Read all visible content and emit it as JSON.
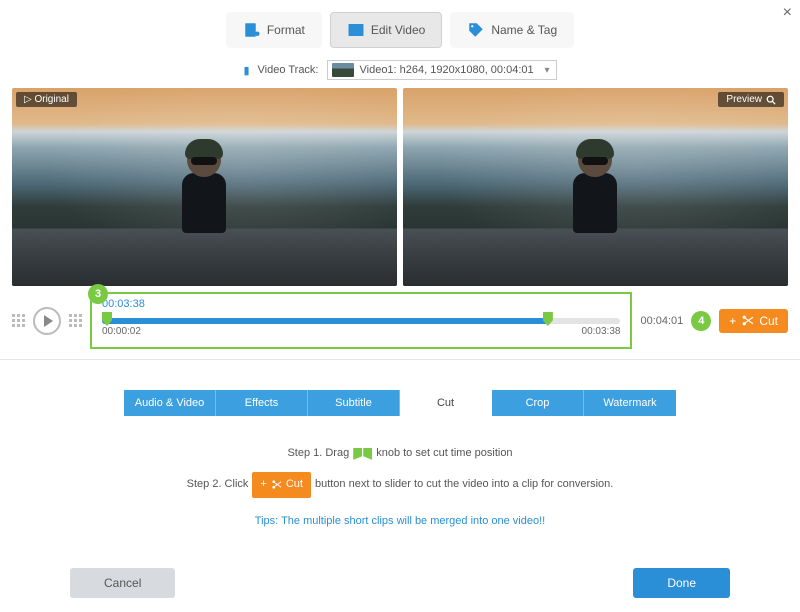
{
  "topTabs": {
    "format": "Format",
    "editVideo": "Edit Video",
    "nameTag": "Name & Tag"
  },
  "trackRow": {
    "label": "Video Track:",
    "selected": "Video1: h264, 1920x1080, 00:04:01"
  },
  "badges": {
    "original": "▷ Original",
    "preview": "Preview"
  },
  "timeline": {
    "current": "00:03:38",
    "total": "00:04:01",
    "startLabel": "00:00:02",
    "endLabel": "00:03:38",
    "cutLabel": "Cut",
    "badge3": "3",
    "badge4": "4"
  },
  "subTabs": {
    "audioVideo": "Audio & Video",
    "effects": "Effects",
    "subtitle": "Subtitle",
    "cut": "Cut",
    "crop": "Crop",
    "watermark": "Watermark"
  },
  "instructions": {
    "step1a": "Step 1. Drag",
    "step1b": "knob to set cut time position",
    "step2a": "Step 2. Click",
    "step2CutLabel": "Cut",
    "step2b": "button next to slider to cut the video into a clip for conversion.",
    "tips": "Tips: The multiple short clips will be merged into one video!!"
  },
  "buttons": {
    "cancel": "Cancel",
    "done": "Done"
  }
}
